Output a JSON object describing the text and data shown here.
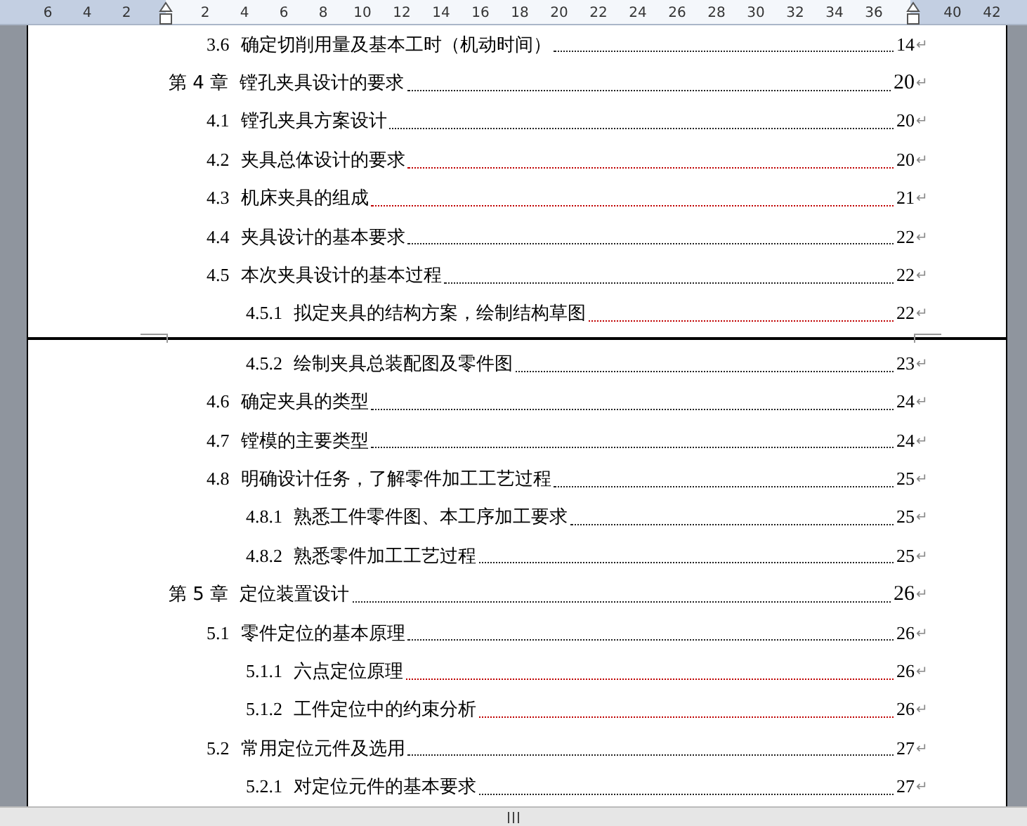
{
  "ruler": {
    "cells": [
      {
        "kind": "number",
        "label": "6"
      },
      {
        "kind": "number",
        "label": "4"
      },
      {
        "kind": "number",
        "label": "2"
      },
      {
        "kind": "marker"
      },
      {
        "kind": "number",
        "label": "2"
      },
      {
        "kind": "number",
        "label": "4"
      },
      {
        "kind": "number",
        "label": "6"
      },
      {
        "kind": "number",
        "label": "8"
      },
      {
        "kind": "number",
        "label": "10"
      },
      {
        "kind": "number",
        "label": "12"
      },
      {
        "kind": "number",
        "label": "14"
      },
      {
        "kind": "number",
        "label": "16"
      },
      {
        "kind": "number",
        "label": "18"
      },
      {
        "kind": "number",
        "label": "20"
      },
      {
        "kind": "number",
        "label": "22"
      },
      {
        "kind": "number",
        "label": "24"
      },
      {
        "kind": "number",
        "label": "26"
      },
      {
        "kind": "number",
        "label": "28"
      },
      {
        "kind": "number",
        "label": "30"
      },
      {
        "kind": "number",
        "label": "32"
      },
      {
        "kind": "number",
        "label": "34"
      },
      {
        "kind": "number",
        "label": "36"
      },
      {
        "kind": "marker"
      },
      {
        "kind": "number",
        "label": "40"
      },
      {
        "kind": "number",
        "label": "42"
      }
    ]
  },
  "pages": [
    {
      "entries": [
        {
          "kind": "section",
          "number": "3.6",
          "title": "确定切削用量及基本工时（机动时间）",
          "page": "14",
          "end_mark": "↵",
          "flagged": false
        },
        {
          "kind": "chapter",
          "number": "第 4 章",
          "title": "镗孔夹具设计的要求",
          "page": "20",
          "end_mark": "↵",
          "flagged": false
        },
        {
          "kind": "section",
          "number": "4.1",
          "title": "镗孔夹具方案设计",
          "page": "20",
          "end_mark": "↵",
          "flagged": false
        },
        {
          "kind": "section",
          "number": "4.2",
          "title": "夹具总体设计的要求",
          "page": "20",
          "end_mark": "↵",
          "flagged": true
        },
        {
          "kind": "section",
          "number": "4.3",
          "title": "机床夹具的组成",
          "page": "21",
          "end_mark": "↵",
          "flagged": true
        },
        {
          "kind": "section",
          "number": "4.4",
          "title": "夹具设计的基本要求",
          "page": "22",
          "end_mark": "↵",
          "flagged": false
        },
        {
          "kind": "section",
          "number": "4.5",
          "title": "本次夹具设计的基本过程",
          "page": "22",
          "end_mark": "↵",
          "flagged": false
        },
        {
          "kind": "subsection",
          "number": "4.5.1",
          "title": "拟定夹具的结构方案，绘制结构草图",
          "page": "22",
          "end_mark": "↵",
          "flagged": true
        }
      ]
    },
    {
      "entries": [
        {
          "kind": "subsection",
          "number": "4.5.2",
          "title": "绘制夹具总装配图及零件图",
          "page": "23",
          "end_mark": "↵",
          "flagged": false
        },
        {
          "kind": "section",
          "number": "4.6",
          "title": "确定夹具的类型",
          "page": "24",
          "end_mark": "↵",
          "flagged": false
        },
        {
          "kind": "section",
          "number": "4.7",
          "title": "镗模的主要类型",
          "page": "24",
          "end_mark": "↵",
          "flagged": false
        },
        {
          "kind": "section",
          "number": "4.8",
          "title": "明确设计任务，了解零件加工工艺过程",
          "page": "25",
          "end_mark": "↵",
          "flagged": false
        },
        {
          "kind": "subsection",
          "number": "4.8.1",
          "title": "熟悉工件零件图、本工序加工要求",
          "page": "25",
          "end_mark": "↵",
          "flagged": false
        },
        {
          "kind": "subsection",
          "number": "4.8.2",
          "title": "熟悉零件加工工艺过程",
          "page": "25",
          "end_mark": "↵",
          "flagged": false
        },
        {
          "kind": "chapter",
          "number": "第 5 章",
          "title": "定位装置设计",
          "page": "26",
          "end_mark": "↵",
          "flagged": false
        },
        {
          "kind": "section",
          "number": "5.1",
          "title": "零件定位的基本原理",
          "page": "26",
          "end_mark": "↵",
          "flagged": false
        },
        {
          "kind": "subsection",
          "number": "5.1.1",
          "title": "六点定位原理",
          "page": "26",
          "end_mark": "↵",
          "flagged": true
        },
        {
          "kind": "subsection",
          "number": "5.1.2",
          "title": "工件定位中的约束分析",
          "page": "26",
          "end_mark": "↵",
          "flagged": true
        },
        {
          "kind": "section",
          "number": "5.2",
          "title": "常用定位元件及选用",
          "page": "27",
          "end_mark": "↵",
          "flagged": false
        },
        {
          "kind": "subsection",
          "number": "5.2.1",
          "title": "对定位元件的基本要求",
          "page": "27",
          "end_mark": "↵",
          "flagged": false
        }
      ]
    }
  ]
}
